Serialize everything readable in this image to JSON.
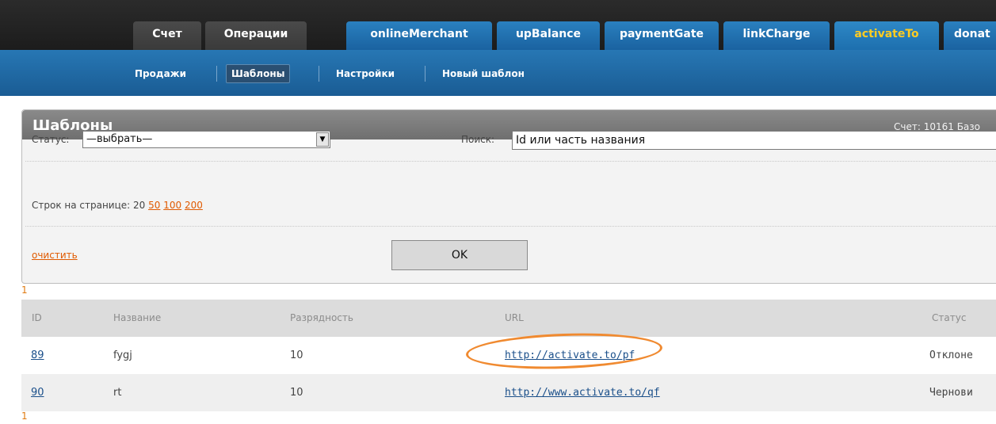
{
  "top_tabs": [
    {
      "label": "Счет"
    },
    {
      "label": "Операции"
    },
    {
      "label": "onlineMerchant"
    },
    {
      "label": "upBalance"
    },
    {
      "label": "paymentGate"
    },
    {
      "label": "linkCharge"
    },
    {
      "label": "activateTo"
    },
    {
      "label": "donat"
    }
  ],
  "sub_nav": [
    {
      "label": "Продажи"
    },
    {
      "label": "Шаблоны"
    },
    {
      "label": "Настройки"
    },
    {
      "label": "Новый шаблон"
    }
  ],
  "panel": {
    "title": "Шаблоны",
    "account": "Счет: 10161   Базо",
    "status_label": "Статус:",
    "status_value": "—выбрать—",
    "search_label": "Поиск:",
    "search_value": "Id или часть названия",
    "rows_label": "Строк на странице: 20",
    "rows_options": [
      "50",
      "100",
      "200"
    ],
    "clear_label": "очистить",
    "ok_label": "OK"
  },
  "pagination": {
    "current": "1"
  },
  "table": {
    "columns": [
      "ID",
      "Название",
      "Разрядность",
      "URL",
      "Статус"
    ],
    "rows": [
      {
        "id": "89",
        "name": "fygj",
        "digits": "10",
        "url": "http://activate.to/pf",
        "status": "Отклоне"
      },
      {
        "id": "90",
        "name": "rt",
        "digits": "10",
        "url": "http://www.activate.to/qf",
        "status": "Чернови"
      }
    ]
  },
  "colors": {
    "top_bar": "#1f1f1f",
    "tab_dark": "#3f3f3f",
    "tab_blue": "#1f6aa8",
    "active_tab_text": "#ffcc22",
    "link_orange": "#e05a00",
    "link_blue": "#1a4f8a",
    "highlight_orange": "#f08a30"
  }
}
